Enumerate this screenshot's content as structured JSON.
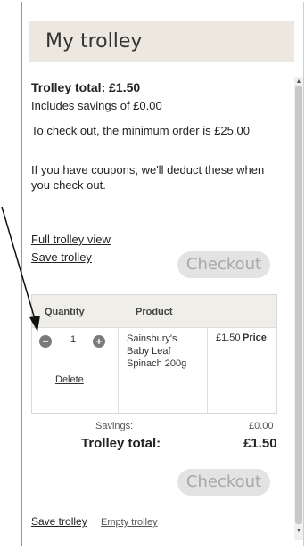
{
  "header": {
    "title": "My trolley"
  },
  "summary": {
    "total": "Trolley total: £1.50",
    "savings": "Includes savings of £0.00",
    "min_order": "To check out, the minimum order is £25.00",
    "coupons": "If you have coupons, we'll deduct these when you check out."
  },
  "links": {
    "full_view": "Full trolley view",
    "save": "Save trolley",
    "save_bottom": "Save trolley",
    "empty": "Empty trolley"
  },
  "buttons": {
    "checkout_top": "Checkout",
    "checkout_bottom": "Checkout"
  },
  "table": {
    "headers": [
      "Quantity",
      "Product",
      "Price"
    ],
    "row": {
      "quantity": "1",
      "delete": "Delete",
      "product": "Sainsbury's Baby Leaf Spinach 200g",
      "price": "£1.50"
    },
    "minus_symbol": "−",
    "plus_symbol": "+"
  },
  "totals": {
    "savings_label": "Savings:",
    "savings_value": "£0.00",
    "total_label": "Trolley total:",
    "total_value": "£1.50"
  },
  "scroll": {
    "up": "▲",
    "down": "▼"
  },
  "colors": {
    "header_bg": "#ece8df",
    "button_bg": "#e3e3e3",
    "button_text": "#a8a8a8"
  }
}
